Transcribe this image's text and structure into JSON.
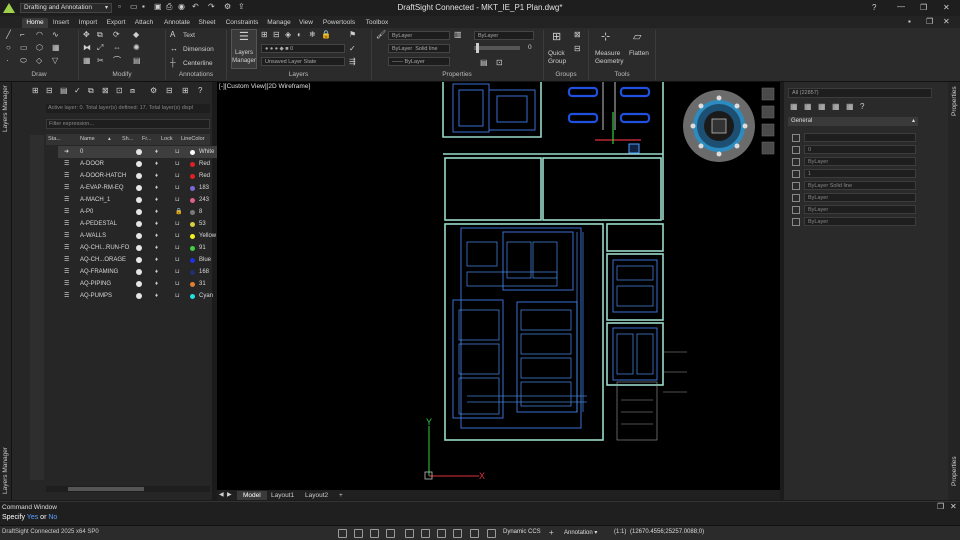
{
  "app": {
    "workspace": "Drafting and Annotation",
    "window_title": "DraftSight Connected - MKT_IE_P1 Plan.dwg*"
  },
  "menu": {
    "tabs": [
      "Home",
      "Insert",
      "Import",
      "Export",
      "Attach",
      "Annotate",
      "Sheet",
      "Constraints",
      "Manage",
      "View",
      "Powertools",
      "Toolbox"
    ],
    "active": "Home"
  },
  "ribbon": {
    "groups": {
      "draw": "Draw",
      "modify": "Modify",
      "annotations": "Annotations",
      "layers": "Layers",
      "properties": "Properties",
      "groups": "Groups",
      "tools": "Tools"
    },
    "annotations": {
      "text": "Text",
      "dimension": "Dimension",
      "centerline": "Centerline"
    },
    "layers_manager": [
      "Layers",
      "Manager"
    ],
    "layer_state": "Unsaved Layer State",
    "prop_color": "ByLayer",
    "prop_layer": "ByLayer",
    "prop_linetype_a": "ByLayer",
    "prop_linetype_b": "Solid line",
    "prop_lineweight": "ByLayer",
    "prop_value": "0",
    "quick_group": [
      "Quick",
      "Group"
    ],
    "measure": [
      "Measure",
      "Geometry"
    ],
    "flatten": "Flatten"
  },
  "layers_panel": {
    "dock_label": "Layers Manager",
    "status_text": "Active layer: 0. Total layer(s) defined: 17. Total layer(s) displ",
    "filter_placeholder": "Filter expression...",
    "columns": [
      "Sta...",
      "Name",
      "Sh...",
      "Fr...",
      "Lock",
      "LineColor"
    ],
    "rows": [
      {
        "name": "0",
        "color_name": "White",
        "color": "#ffffff",
        "locked": false
      },
      {
        "name": "A-DOOR",
        "color_name": "Red",
        "color": "#e02020",
        "locked": false
      },
      {
        "name": "A-DOOR-HATCH",
        "color_name": "Red",
        "color": "#e02020",
        "locked": false
      },
      {
        "name": "A-EVAP-RM-EQ",
        "color_name": "183",
        "color": "#7a6ad6",
        "locked": false
      },
      {
        "name": "A-MACH_1",
        "color_name": "243",
        "color": "#e0608a",
        "locked": false
      },
      {
        "name": "A-P0",
        "color_name": "8",
        "color": "#7a7a7a",
        "locked": true
      },
      {
        "name": "A-PEDESTAL",
        "color_name": "53",
        "color": "#d8d040",
        "locked": false
      },
      {
        "name": "A-WALLS",
        "color_name": "Yellow",
        "color": "#f0f020",
        "locked": false
      },
      {
        "name": "AQ-CHI...RUN-FO",
        "color_name": "91",
        "color": "#40d040",
        "locked": false
      },
      {
        "name": "AQ-CH...ORAGE",
        "color_name": "Blue",
        "color": "#2030e0",
        "locked": false
      },
      {
        "name": "AQ-FRAMING",
        "color_name": "168",
        "color": "#203070",
        "locked": false
      },
      {
        "name": "AQ-PIPING",
        "color_name": "31",
        "color": "#e08030",
        "locked": false
      },
      {
        "name": "AQ-PUMPS",
        "color_name": "Cyan",
        "color": "#20e0e0",
        "locked": false
      }
    ]
  },
  "viewport": {
    "label": "[-][Custom View][2D Wireframe]",
    "tabs": [
      "Model",
      "Layout1",
      "Layout2"
    ],
    "active_tab": "Model",
    "add_tab": "+"
  },
  "properties_panel": {
    "dock_label": "Properties",
    "selection": "All (22857)",
    "section": "General",
    "fields": [
      "",
      "0",
      "ByLayer",
      "1",
      "ByLayer     Solid line",
      "ByLayer",
      "ByLayer",
      "ByLayer"
    ]
  },
  "command_window": {
    "title": "Command Window",
    "prompt": "Specify",
    "option_yes": "Yes",
    "option_or": "or",
    "option_no": "No"
  },
  "status": {
    "version": "DraftSight Connected 2025  x64 SP0",
    "ccs": "Dynamic CCS",
    "annotation": "Annotation",
    "scale": "(1:1)",
    "coords": "(12670.4556;25257.0088;0)"
  }
}
